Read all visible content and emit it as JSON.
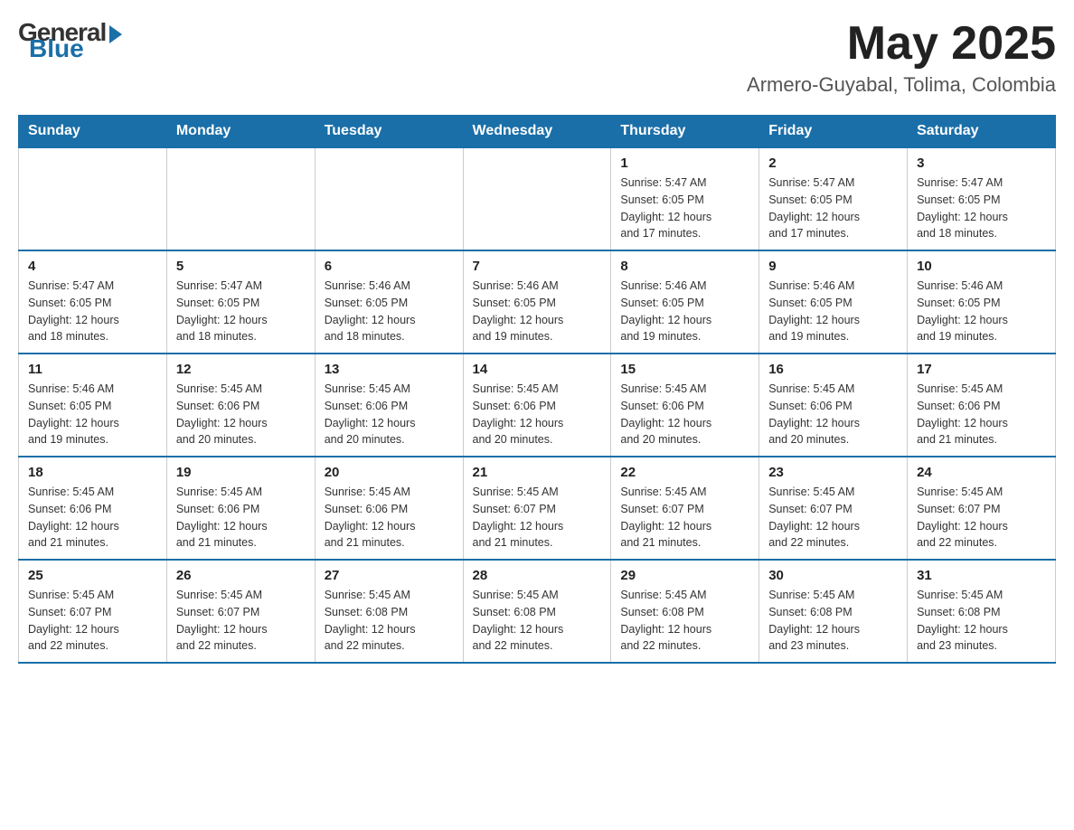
{
  "header": {
    "month_year": "May 2025",
    "location": "Armero-Guyabal, Tolima, Colombia"
  },
  "days_of_week": [
    "Sunday",
    "Monday",
    "Tuesday",
    "Wednesday",
    "Thursday",
    "Friday",
    "Saturday"
  ],
  "weeks": [
    [
      {
        "day": "",
        "info": ""
      },
      {
        "day": "",
        "info": ""
      },
      {
        "day": "",
        "info": ""
      },
      {
        "day": "",
        "info": ""
      },
      {
        "day": "1",
        "info": "Sunrise: 5:47 AM\nSunset: 6:05 PM\nDaylight: 12 hours\nand 17 minutes."
      },
      {
        "day": "2",
        "info": "Sunrise: 5:47 AM\nSunset: 6:05 PM\nDaylight: 12 hours\nand 17 minutes."
      },
      {
        "day": "3",
        "info": "Sunrise: 5:47 AM\nSunset: 6:05 PM\nDaylight: 12 hours\nand 18 minutes."
      }
    ],
    [
      {
        "day": "4",
        "info": "Sunrise: 5:47 AM\nSunset: 6:05 PM\nDaylight: 12 hours\nand 18 minutes."
      },
      {
        "day": "5",
        "info": "Sunrise: 5:47 AM\nSunset: 6:05 PM\nDaylight: 12 hours\nand 18 minutes."
      },
      {
        "day": "6",
        "info": "Sunrise: 5:46 AM\nSunset: 6:05 PM\nDaylight: 12 hours\nand 18 minutes."
      },
      {
        "day": "7",
        "info": "Sunrise: 5:46 AM\nSunset: 6:05 PM\nDaylight: 12 hours\nand 19 minutes."
      },
      {
        "day": "8",
        "info": "Sunrise: 5:46 AM\nSunset: 6:05 PM\nDaylight: 12 hours\nand 19 minutes."
      },
      {
        "day": "9",
        "info": "Sunrise: 5:46 AM\nSunset: 6:05 PM\nDaylight: 12 hours\nand 19 minutes."
      },
      {
        "day": "10",
        "info": "Sunrise: 5:46 AM\nSunset: 6:05 PM\nDaylight: 12 hours\nand 19 minutes."
      }
    ],
    [
      {
        "day": "11",
        "info": "Sunrise: 5:46 AM\nSunset: 6:05 PM\nDaylight: 12 hours\nand 19 minutes."
      },
      {
        "day": "12",
        "info": "Sunrise: 5:45 AM\nSunset: 6:06 PM\nDaylight: 12 hours\nand 20 minutes."
      },
      {
        "day": "13",
        "info": "Sunrise: 5:45 AM\nSunset: 6:06 PM\nDaylight: 12 hours\nand 20 minutes."
      },
      {
        "day": "14",
        "info": "Sunrise: 5:45 AM\nSunset: 6:06 PM\nDaylight: 12 hours\nand 20 minutes."
      },
      {
        "day": "15",
        "info": "Sunrise: 5:45 AM\nSunset: 6:06 PM\nDaylight: 12 hours\nand 20 minutes."
      },
      {
        "day": "16",
        "info": "Sunrise: 5:45 AM\nSunset: 6:06 PM\nDaylight: 12 hours\nand 20 minutes."
      },
      {
        "day": "17",
        "info": "Sunrise: 5:45 AM\nSunset: 6:06 PM\nDaylight: 12 hours\nand 21 minutes."
      }
    ],
    [
      {
        "day": "18",
        "info": "Sunrise: 5:45 AM\nSunset: 6:06 PM\nDaylight: 12 hours\nand 21 minutes."
      },
      {
        "day": "19",
        "info": "Sunrise: 5:45 AM\nSunset: 6:06 PM\nDaylight: 12 hours\nand 21 minutes."
      },
      {
        "day": "20",
        "info": "Sunrise: 5:45 AM\nSunset: 6:06 PM\nDaylight: 12 hours\nand 21 minutes."
      },
      {
        "day": "21",
        "info": "Sunrise: 5:45 AM\nSunset: 6:07 PM\nDaylight: 12 hours\nand 21 minutes."
      },
      {
        "day": "22",
        "info": "Sunrise: 5:45 AM\nSunset: 6:07 PM\nDaylight: 12 hours\nand 21 minutes."
      },
      {
        "day": "23",
        "info": "Sunrise: 5:45 AM\nSunset: 6:07 PM\nDaylight: 12 hours\nand 22 minutes."
      },
      {
        "day": "24",
        "info": "Sunrise: 5:45 AM\nSunset: 6:07 PM\nDaylight: 12 hours\nand 22 minutes."
      }
    ],
    [
      {
        "day": "25",
        "info": "Sunrise: 5:45 AM\nSunset: 6:07 PM\nDaylight: 12 hours\nand 22 minutes."
      },
      {
        "day": "26",
        "info": "Sunrise: 5:45 AM\nSunset: 6:07 PM\nDaylight: 12 hours\nand 22 minutes."
      },
      {
        "day": "27",
        "info": "Sunrise: 5:45 AM\nSunset: 6:08 PM\nDaylight: 12 hours\nand 22 minutes."
      },
      {
        "day": "28",
        "info": "Sunrise: 5:45 AM\nSunset: 6:08 PM\nDaylight: 12 hours\nand 22 minutes."
      },
      {
        "day": "29",
        "info": "Sunrise: 5:45 AM\nSunset: 6:08 PM\nDaylight: 12 hours\nand 22 minutes."
      },
      {
        "day": "30",
        "info": "Sunrise: 5:45 AM\nSunset: 6:08 PM\nDaylight: 12 hours\nand 23 minutes."
      },
      {
        "day": "31",
        "info": "Sunrise: 5:45 AM\nSunset: 6:08 PM\nDaylight: 12 hours\nand 23 minutes."
      }
    ]
  ]
}
